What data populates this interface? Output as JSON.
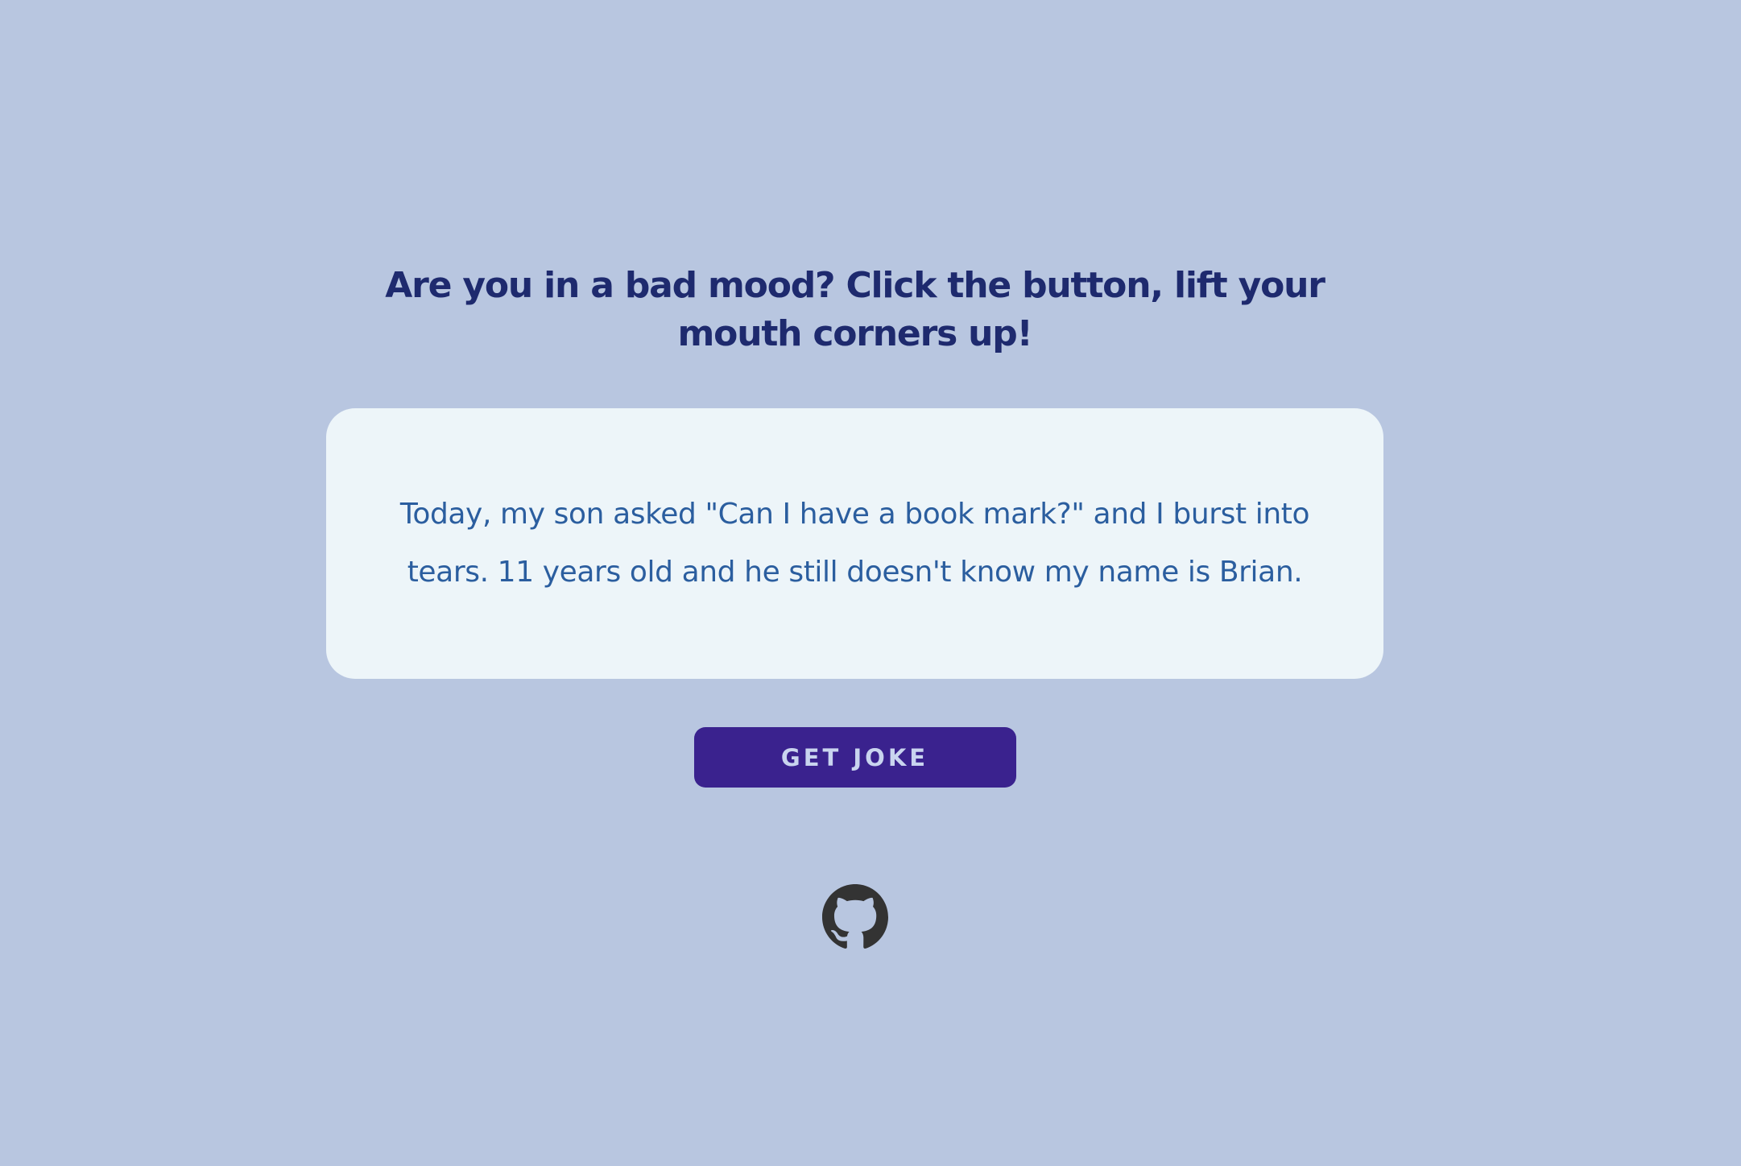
{
  "page": {
    "heading": "Are you in a bad mood? Click the button, lift your mouth corners up!"
  },
  "joke": {
    "text": "Today, my son asked \"Can I have a book mark?\" and I burst into tears. 11 years old and he still doesn't know my name is Brian."
  },
  "button": {
    "label": "GET JOKE"
  },
  "footer": {
    "icon": "github-icon"
  },
  "colors": {
    "background": "#b8c6e0",
    "heading": "#1e2a6e",
    "card": "#edf5f9",
    "joke_text": "#2b5e9f",
    "button": "#3a228e",
    "button_text": "#c9d4ef",
    "icon": "#333333"
  }
}
